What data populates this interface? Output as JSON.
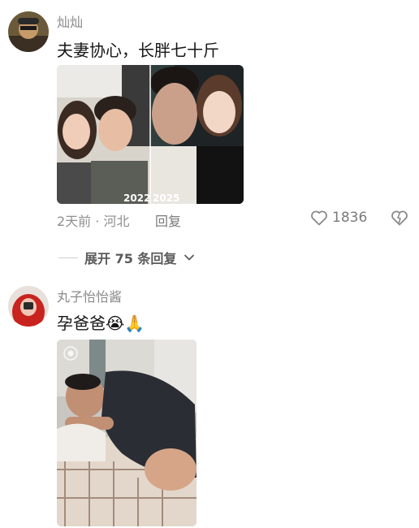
{
  "comments": [
    {
      "username": "灿灿",
      "text": "夫妻协心，长胖七十斤",
      "photo": {
        "labels": [
          "2022",
          "2025"
        ]
      },
      "meta": "2天前 · 河北",
      "reply_label": "回复",
      "like_count": "1836",
      "expand_label": "展开 75 条回复"
    },
    {
      "username": "丸子怡怡酱",
      "text": "孕爸爸",
      "emoji_1": "😭",
      "emoji_2": "🙏"
    }
  ],
  "colors": {
    "text_primary": "#161616",
    "text_secondary": "#8a8a8a",
    "divider": "#cfcfcf"
  }
}
